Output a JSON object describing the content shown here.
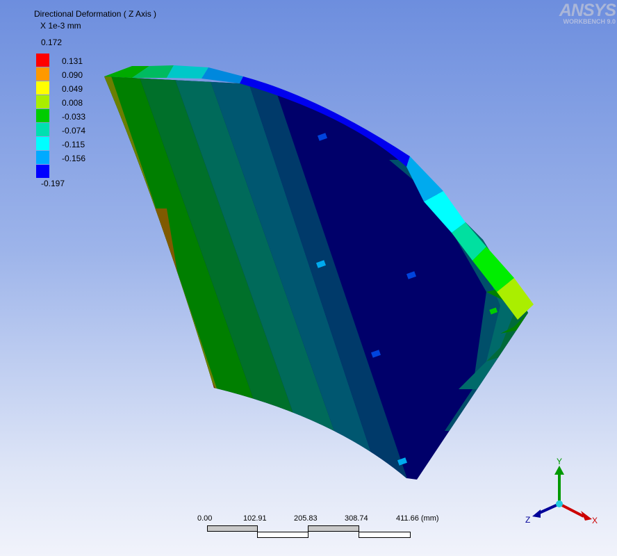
{
  "result": {
    "title": "Directional Deformation ( Z Axis )",
    "units": "X 1e-3 mm",
    "max": "0.172",
    "min": "-0.197"
  },
  "legend": {
    "entries": [
      {
        "color": "#ff0000",
        "label": "0.131"
      },
      {
        "color": "#ff9900",
        "label": "0.090"
      },
      {
        "color": "#ffff00",
        "label": "0.049"
      },
      {
        "color": "#aaee00",
        "label": "0.008"
      },
      {
        "color": "#00cc00",
        "label": "-0.033"
      },
      {
        "color": "#00e0b0",
        "label": "-0.074"
      },
      {
        "color": "#00ffff",
        "label": "-0.115"
      },
      {
        "color": "#00aaff",
        "label": "-0.156"
      },
      {
        "color": "#0000ff",
        "label": ""
      }
    ]
  },
  "logo": {
    "brand": "ANSYS",
    "version": "WORKBENCH 9.0"
  },
  "scale_bar": {
    "ticks": [
      "0.00",
      "102.91",
      "205.83",
      "308.74",
      "411.66 (mm)"
    ]
  },
  "triad": {
    "x_label": "X",
    "y_label": "Y",
    "z_label": "Z"
  }
}
